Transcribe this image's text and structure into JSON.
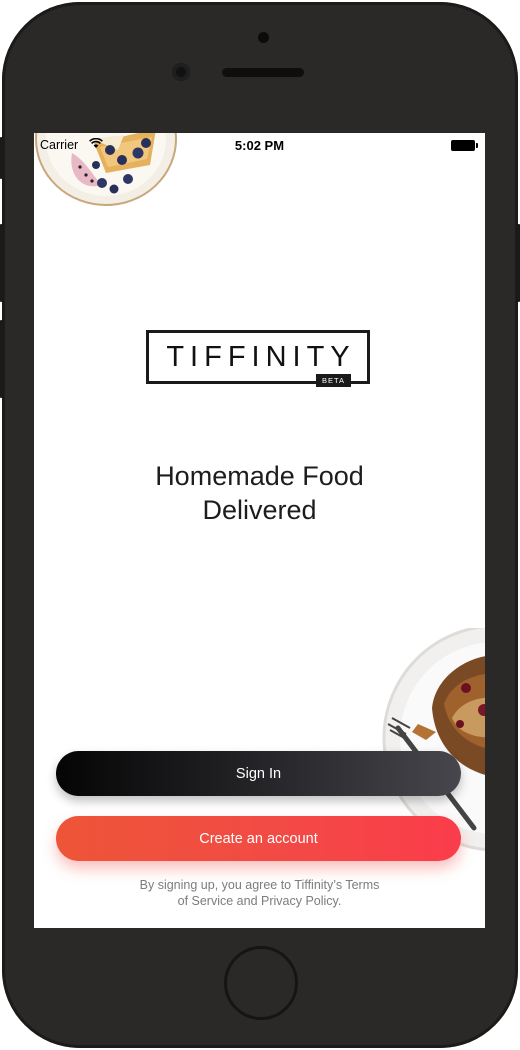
{
  "status_bar": {
    "carrier": "Carrier",
    "time": "5:02 PM"
  },
  "logo": {
    "text": "TIFFINITY",
    "badge": "BETA"
  },
  "headline": {
    "line1": "Homemade Food",
    "line2": "Delivered"
  },
  "buttons": {
    "sign_in": "Sign In",
    "create_account": "Create an account"
  },
  "terms": {
    "line1": "By signing up, you agree to Tiffinity’s Terms",
    "line2": "of Service and Privacy Policy."
  },
  "colors": {
    "sign_in_gradient": [
      "#050505",
      "#46464c"
    ],
    "create_gradient": [
      "#ee5537",
      "#fb3c4b"
    ],
    "device_body": "#2b2928"
  },
  "icons": [
    "wifi-icon",
    "battery-icon",
    "food-plate-image"
  ]
}
